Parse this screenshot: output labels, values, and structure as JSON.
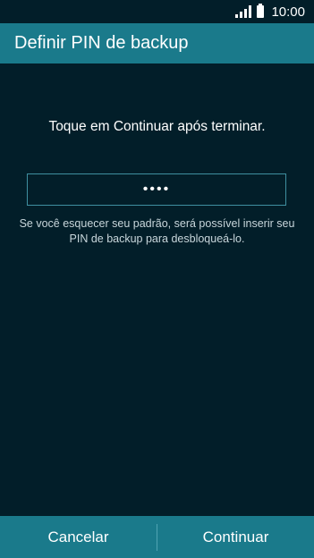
{
  "status_bar": {
    "time": "10:00",
    "signal_icon": "signal-bars-icon",
    "battery_icon": "battery-icon"
  },
  "header": {
    "title": "Definir PIN de backup"
  },
  "main": {
    "instruction": "Toque em Continuar após terminar.",
    "pin_value": "••••",
    "hint_line1": "Se você esquecer seu padrão, será possível inserir seu",
    "hint_line2": "PIN de backup para desbloqueá-lo."
  },
  "footer": {
    "cancel_label": "Cancelar",
    "continue_label": "Continuar"
  },
  "colors": {
    "background": "#021e29",
    "accent": "#1a7a8b"
  }
}
